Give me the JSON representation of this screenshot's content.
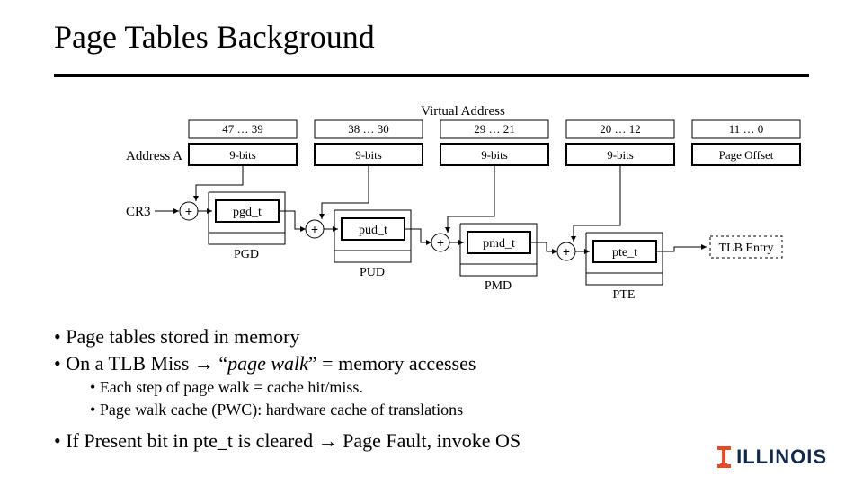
{
  "title": "Page Tables Background",
  "virtual_address": {
    "label": "Virtual Address",
    "ranges": [
      "47 … 39",
      "38 … 30",
      "29 … 21",
      "20 … 12",
      "11 … 0"
    ]
  },
  "address_row": {
    "label": "Address A",
    "cells": [
      "9-bits",
      "9-bits",
      "9-bits",
      "9-bits",
      "Page Offset"
    ]
  },
  "walk": {
    "cr3": "CR3",
    "entries": [
      "pgd_t",
      "pud_t",
      "pmd_t",
      "pte_t"
    ],
    "tables": [
      "PGD",
      "PUD",
      "PMD",
      "PTE"
    ],
    "tlb": "TLB Entry"
  },
  "bullets": {
    "b1": "Page tables stored in memory",
    "b2_pre": "On a TLB Miss ",
    "b2_arrow": "→",
    "b2_post": " “page walk” = memory accesses",
    "b2a": "Each step of page walk = cache hit/miss.",
    "b2b": "Page walk cache (PWC): hardware cache of translations",
    "b3_pre": "If Present bit in pte_t is cleared ",
    "b3_arrow": "→",
    "b3_post": " Page Fault, invoke OS",
    "italic": "page walk"
  },
  "logo": "ILLINOIS",
  "colors": {
    "orange": "#e84a27",
    "navy": "#13294b"
  }
}
